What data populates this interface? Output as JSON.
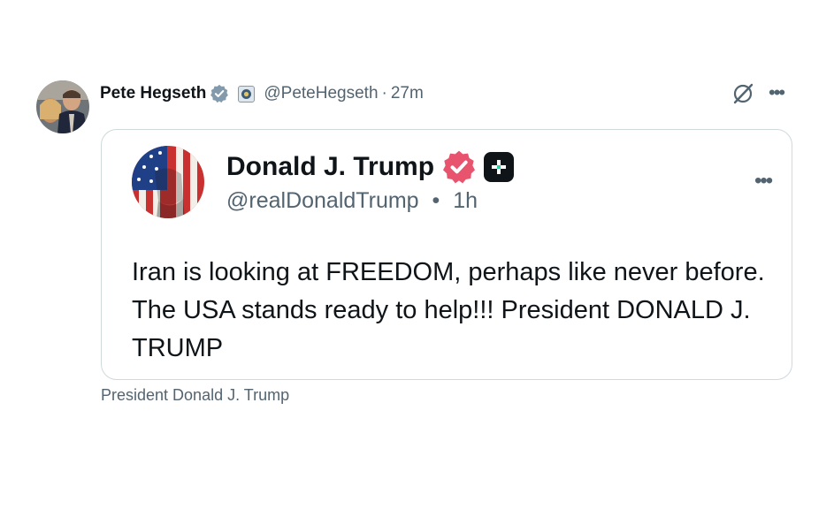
{
  "author": {
    "name": "Pete Hegseth",
    "handle": "@PeteHegseth",
    "separator": "·",
    "time": "27m"
  },
  "quoted_post": {
    "name": "Donald J. Trump",
    "handle": "@realDonaldTrump",
    "separator": "•",
    "time": "1h",
    "text": "Iran is looking at FREEDOM, perhaps like never before. The USA stands ready to help!!! President DONALD J. TRUMP"
  },
  "source_label": "President Donald J. Trump",
  "icons": {
    "author_verified": "verified-badge-icon",
    "affiliation": "affiliation-badge-icon",
    "grok": "grok-icon",
    "more": "more-options-icon",
    "quote_verified": "verified-badge-icon",
    "plus": "plus-badge-icon"
  },
  "colors": {
    "text_primary": "#0f1419",
    "text_secondary": "#536471",
    "border": "#cfd9de",
    "verified_gray": "#829aab",
    "verified_pink": "#e8536d"
  }
}
